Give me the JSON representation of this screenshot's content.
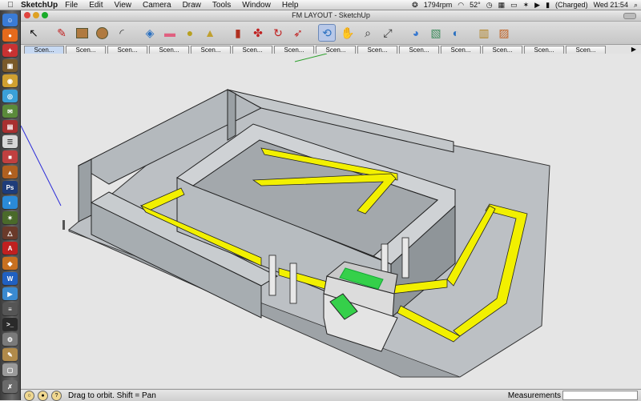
{
  "menubar": {
    "app_name": "SketchUp",
    "menus": [
      "File",
      "Edit",
      "View",
      "Camera",
      "Draw",
      "Tools",
      "Window",
      "Help"
    ],
    "status": {
      "fan": "1794rpm",
      "temp": "52°",
      "battery": "(Charged)",
      "clock": "Wed 21:54"
    }
  },
  "window": {
    "title": "FM LAYOUT - SketchUp"
  },
  "toolbar": {
    "tools": [
      "select-arrow",
      "pencil",
      "rectangle",
      "circle",
      "arc",
      "eraser-box",
      "eraser",
      "tape-measure",
      "paint-bucket",
      "push-pull",
      "move",
      "rotate",
      "follow-me",
      "orbit",
      "pan",
      "zoom",
      "zoom-extents",
      "previous-view",
      "next-view",
      "get-models",
      "share-model",
      "place-component"
    ]
  },
  "scenes": {
    "tab_label": "Scen...",
    "count": 15
  },
  "status": {
    "hint": "Drag to orbit.  Shift = Pan",
    "measurements_label": "Measurements",
    "measurements_value": ""
  },
  "colors": {
    "accent_yellow": "#f2f000",
    "model_wall": "#aeb4b8",
    "ground": "#bcc0c4",
    "screen_green": "#35d04a"
  }
}
